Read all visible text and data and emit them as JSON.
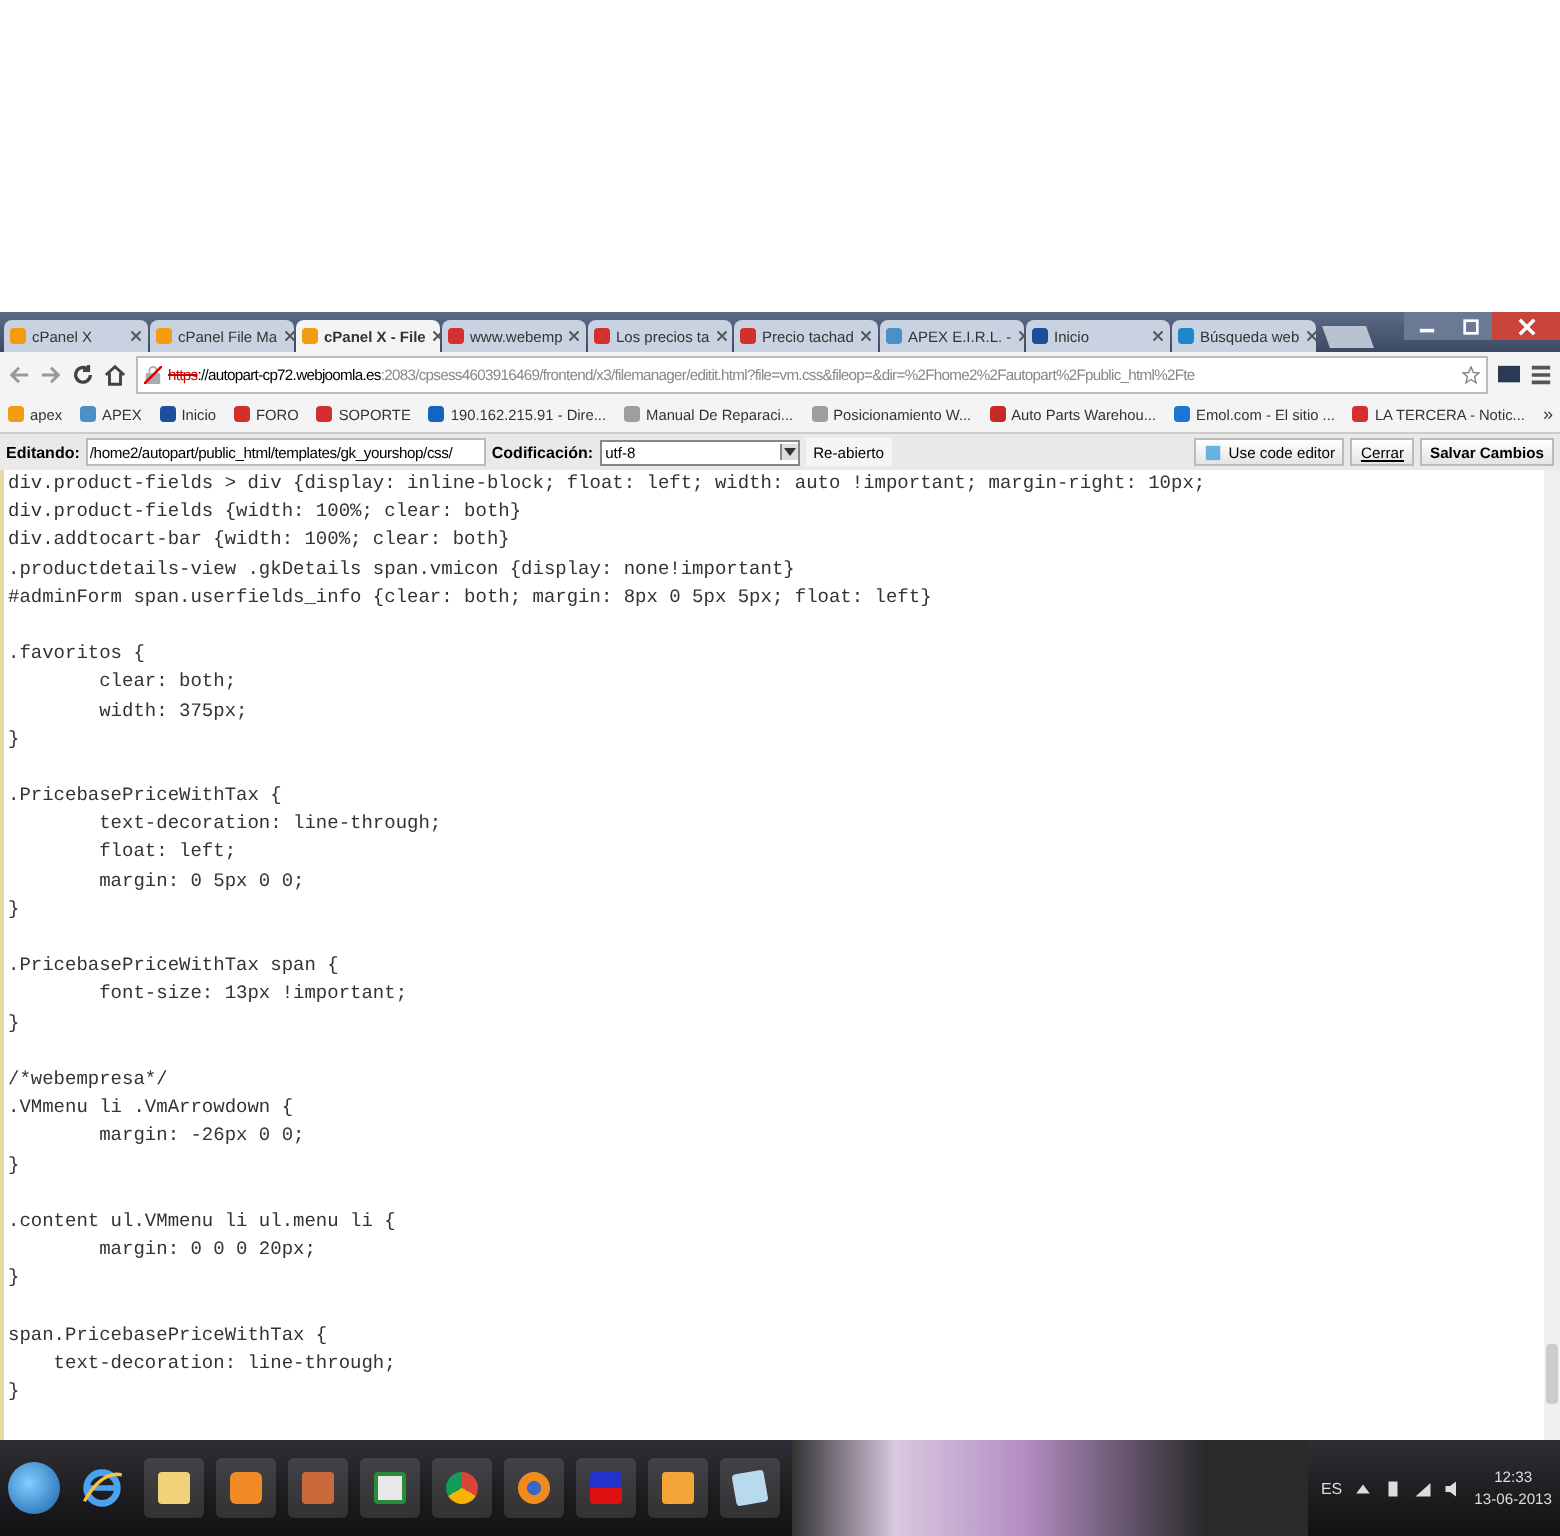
{
  "browser": {
    "tabs": [
      {
        "title": "cPanel X",
        "selected": false,
        "color": "#f39c12"
      },
      {
        "title": "cPanel File Ma",
        "selected": false,
        "color": "#f39c12"
      },
      {
        "title": "cPanel X - File",
        "selected": true,
        "color": "#f39c12"
      },
      {
        "title": "www.webemp",
        "selected": false,
        "color": "#d32f2f"
      },
      {
        "title": "Los precios ta",
        "selected": false,
        "color": "#d32f2f"
      },
      {
        "title": "Precio tachad",
        "selected": false,
        "color": "#d32f2f"
      },
      {
        "title": "APEX E.I.R.L. -",
        "selected": false,
        "color": "#4a90c8"
      },
      {
        "title": "Inicio",
        "selected": false,
        "color": "#1e4f9c"
      },
      {
        "title": "Búsqueda web",
        "selected": false,
        "color": "#1a88c9"
      }
    ],
    "address": {
      "scheme": "https",
      "rest": "://autopart-cp72.webjoomla.es",
      "tail": ":2083/cpsess4603916469/frontend/x3/filemanager/editit.html?file=vm.css&fileop=&dir=%2Fhome2%2Fautopart%2Fpublic_html%2Fte"
    },
    "bookmarks": [
      {
        "label": "apex",
        "color": "#f39c12"
      },
      {
        "label": "APEX",
        "color": "#4a90c8"
      },
      {
        "label": "Inicio",
        "color": "#1e4f9c"
      },
      {
        "label": "FORO",
        "color": "#d32f2f"
      },
      {
        "label": "SOPORTE",
        "color": "#d32f2f"
      },
      {
        "label": "190.162.215.91 - Dire...",
        "color": "#1565c0"
      },
      {
        "label": "Manual De Reparaci...",
        "color": "#9e9e9e"
      },
      {
        "label": "Posicionamiento W...",
        "color": "#9e9e9e"
      },
      {
        "label": "Auto Parts Warehou...",
        "color": "#c62828"
      },
      {
        "label": "Emol.com - El sitio ...",
        "color": "#1976d2"
      },
      {
        "label": "LA TERCERA - Notic...",
        "color": "#d32f2f"
      }
    ],
    "bookmarks_more": "»"
  },
  "editor": {
    "editing_label": "Editando:",
    "path": "/home2/autopart/public_html/templates/gk_yourshop/css/",
    "encoding_label": "Codificación:",
    "encoding": "utf-8",
    "reopen": "Re-abierto",
    "code_editor_button": "Use code editor",
    "close_button": "Cerrar",
    "save_button": "Salvar Cambios",
    "blocks": [
      [
        "div.product-fields > div {display: inline-block; float: left; width: auto !important; margin-right: 10px;",
        "div.product-fields {width: 100%; clear: both}",
        "div.addtocart-bar {width: 100%; clear: both}",
        ".productdetails-view .gkDetails span.vmicon {display: none!important}",
        "#adminForm span.userfields_info {clear: both; margin: 8px 0 5px 5px; float: left}"
      ],
      [
        ".favoritos {",
        "\tclear: both;",
        "\twidth: 375px;",
        "}"
      ],
      [
        ".PricebasePriceWithTax {",
        "\ttext-decoration: line-through;",
        "\tfloat: left;",
        "\tmargin: 0 5px 0 0;",
        "}"
      ],
      [
        ".PricebasePriceWithTax span {",
        "\tfont-size: 13px !important;",
        "}"
      ],
      [
        "/*webempresa*/",
        ".VMmenu li .VmArrowdown {",
        "\tmargin: -26px 0 0;",
        "}"
      ],
      [
        ".content ul.VMmenu li ul.menu li {",
        "\tmargin: 0 0 0 20px;",
        "}"
      ],
      [
        "span.PricebasePriceWithTax {",
        "    text-decoration: line-through;",
        "}"
      ]
    ]
  },
  "taskbar": {
    "language": "ES",
    "time": "12:33",
    "date": "13-06-2013"
  }
}
